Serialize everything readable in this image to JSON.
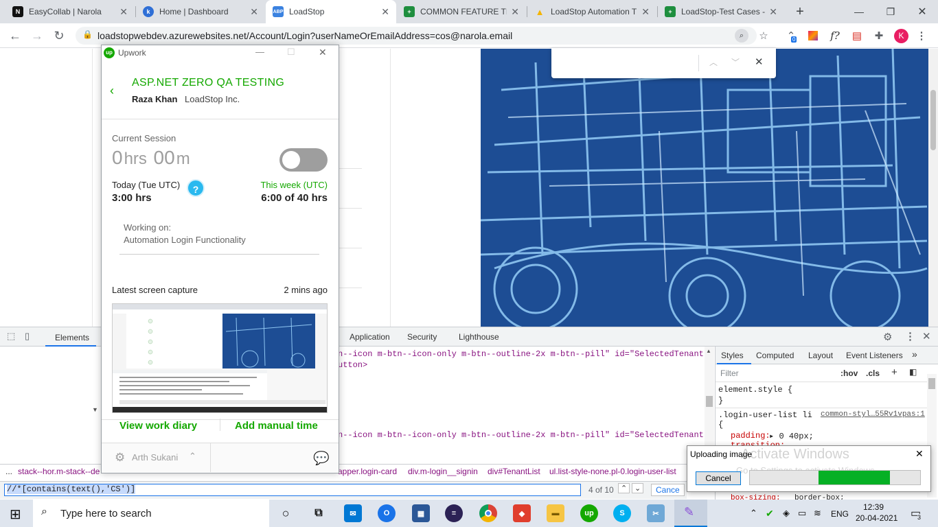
{
  "browser": {
    "tabs": [
      {
        "title": "EasyCollab | Narola",
        "fav": "N",
        "favColor": "#111111"
      },
      {
        "title": "Home | Dashboard",
        "fav": "k",
        "favColor": "#2f6fd6"
      },
      {
        "title": "LoadStop",
        "fav": "ABP",
        "favColor": "#3b82e0"
      },
      {
        "title": "COMMON FEATURE TE",
        "fav": "+",
        "favColor": "#1e8e3e"
      },
      {
        "title": "LoadStop Automation T",
        "fav": "▲",
        "favColor": "#f4b400"
      },
      {
        "title": "LoadStop-Test Cases - C",
        "fav": "+",
        "favColor": "#1e8e3e"
      }
    ],
    "url": "loadstopwebdev.azurewebsites.net/Account/Login?userNameOrEmailAddress=cos@narola.email",
    "ext_badge": "0",
    "profile_initial": "K",
    "font_ext": "f?"
  },
  "upwork": {
    "app_name": "Upwork",
    "logo": "up",
    "project": "ASP.NET ZERO QA TESTING",
    "client_name": "Raza Khan",
    "company": "LoadStop Inc.",
    "session_label": "Current Session",
    "session_hrs": "0",
    "hrs_unit": "hrs",
    "session_min": "00",
    "min_unit": "m",
    "today_label": "Today (Tue UTC)",
    "today_value": "3:00 hrs",
    "week_label": "This week (UTC)",
    "week_value": "6:00 of 40 hrs",
    "help": "?",
    "working_label": "Working on:",
    "working_task": "Automation Login Functionality",
    "capture_label": "Latest screen capture",
    "capture_time": "2 mins ago",
    "diary_link": "View work diary",
    "manual_link": "Add manual time",
    "user": "Arth Sukani",
    "accent": "#14a800"
  },
  "devtools": {
    "tabs": [
      "Elements",
      "Application",
      "Security",
      "Lighthouse"
    ],
    "code_line_1": "n--icon m-btn--icon-only m-btn--outline-2x m-btn--pill\" id=\"SelectedTenant\"",
    "code_line_2": "utton>",
    "code_line_3": "n--icon m-btn--icon-only m-btn--outline-2x m-btn--pill\" id=\"SelectedTenant\"",
    "style_tabs": [
      "Styles",
      "Computed",
      "Layout",
      "Event Listeners"
    ],
    "filter_placeholder": "Filter",
    "hov": ":hov",
    "cls": ".cls",
    "rule1": "element.style {",
    "rule1_close": "}",
    "rule2_selector": ".login-user-list li",
    "rule2_source": "common-styl…55Rv1vpas:1",
    "rule2_open": "{",
    "prop_padding": "padding:",
    "val_padding": "0 40px;",
    "prop_transition": "transition:",
    "val_transition": ".3s all;",
    "prop_boxsizing": "box-sizing:",
    "val_boxsizing": "border-box;",
    "breadcrumbs": [
      "...",
      "stack--hor.m-stack--de",
      "apper.login-card",
      "div.m-login__signin",
      "div#TenantList",
      "ul.list-style-none.pl-0.login-user-list"
    ],
    "search_query": "//*[contains(text(),'CS')]",
    "match_count": "4 of 10",
    "cancel": "Cance"
  },
  "upload_dialog": {
    "title": "Uploading image",
    "cancel": "Cancel",
    "progress": 0.7,
    "watermark_1": "Activate Windows",
    "watermark_2": "Go to Settings to activate Windows."
  },
  "taskbar": {
    "search_placeholder": "Type here to search",
    "language": "ENG",
    "time": "12:39",
    "date": "20-04-2021",
    "notifications": "3"
  }
}
